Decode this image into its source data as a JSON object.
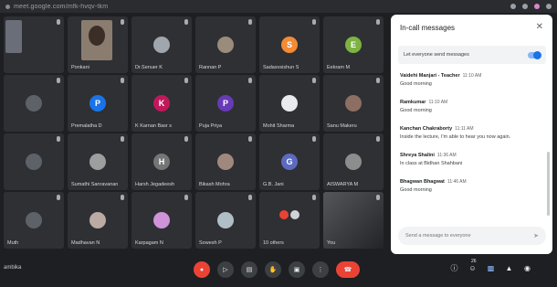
{
  "browser": {
    "url": "meet.google.com/mfk-hvqv-tkm"
  },
  "grid": {
    "tiles": [
      {
        "name": "",
        "type": "video-peer",
        "avatar_color": "#3a3b3f"
      },
      {
        "name": "Ponkani",
        "type": "video-photo",
        "avatar_color": "#8a7d70"
      },
      {
        "name": "Dr.Senuer K",
        "type": "avatar",
        "avatar_letter": "",
        "avatar_color": "#a0a6ad"
      },
      {
        "name": "Rannan P",
        "type": "avatar",
        "avatar_letter": "",
        "avatar_color": "#9a8c7c"
      },
      {
        "name": "Sadasvsishun S",
        "type": "avatar",
        "avatar_letter": "S",
        "avatar_color": "#f28b33"
      },
      {
        "name": "Eekram M",
        "type": "avatar",
        "avatar_letter": "E",
        "avatar_color": "#7cb342"
      },
      {
        "name": "",
        "type": "avatar",
        "avatar_letter": "",
        "avatar_color": "#5d6268"
      },
      {
        "name": "Premalatha D",
        "type": "avatar",
        "avatar_letter": "P",
        "avatar_color": "#1a73e8"
      },
      {
        "name": "K Karnan Basr s",
        "type": "avatar",
        "avatar_letter": "K",
        "avatar_color": "#c2185b"
      },
      {
        "name": "Puja Priya",
        "type": "avatar",
        "avatar_letter": "P",
        "avatar_color": "#673ab7"
      },
      {
        "name": "Mohit Sharma",
        "type": "avatar",
        "avatar_letter": "",
        "avatar_color": "#e8eaed"
      },
      {
        "name": "Sanu Makeru",
        "type": "avatar",
        "avatar_letter": "",
        "avatar_color": "#8d6e63"
      },
      {
        "name": "",
        "type": "avatar",
        "avatar_letter": "",
        "avatar_color": "#5d6268"
      },
      {
        "name": "Sumathi Sanravanan",
        "type": "avatar",
        "avatar_letter": "",
        "avatar_color": "#9e9e9e"
      },
      {
        "name": "Harsh Jegadeesh",
        "type": "avatar",
        "avatar_letter": "H",
        "avatar_color": "#757575"
      },
      {
        "name": "Bikash Mohra",
        "type": "avatar",
        "avatar_letter": "",
        "avatar_color": "#a1887f"
      },
      {
        "name": "G.B. Jani",
        "type": "avatar",
        "avatar_letter": "G",
        "avatar_color": "#5c6bc0"
      },
      {
        "name": "AISWARYA M",
        "type": "avatar",
        "avatar_letter": "",
        "avatar_color": "#8d8d8d"
      },
      {
        "name": "Muth",
        "type": "avatar",
        "avatar_letter": "",
        "avatar_color": "#5d6268"
      },
      {
        "name": "Madhavan N",
        "type": "avatar",
        "avatar_letter": "",
        "avatar_color": "#bcaaa4"
      },
      {
        "name": "Karpagam N",
        "type": "avatar",
        "avatar_letter": "",
        "avatar_color": "#ce93d8"
      },
      {
        "name": "Sowesh P",
        "type": "avatar",
        "avatar_letter": "",
        "avatar_color": "#b0bec5"
      },
      {
        "name": "10 others",
        "type": "others",
        "avatar_letter": "",
        "avatar_color": "#cfd2d6"
      },
      {
        "name": "You",
        "type": "self-video",
        "avatar_letter": "",
        "avatar_color": "#4a4b4f"
      }
    ]
  },
  "meeting": {
    "name": "ambika"
  },
  "controls": {
    "mic_label": "mic",
    "camera_label": "cam",
    "captions_label": "cc",
    "hand_label": "hand",
    "present_label": "present",
    "more_label": "more",
    "end_label": "end"
  },
  "right_controls": {
    "participants_count": "26"
  },
  "chat": {
    "title": "In-call messages",
    "toggle_label": "Let everyone send messages",
    "messages": [
      {
        "sender": "Vaidehi Manjari - Teacher",
        "time": "11:10 AM",
        "text": "Good morning"
      },
      {
        "sender": "Ramkumar",
        "time": "11:10 AM",
        "text": "Good morning"
      },
      {
        "sender": "Kanchan Chakraborty",
        "time": "11:11 AM",
        "text": "Inside the lecture, I'm able to hear you now again."
      },
      {
        "sender": "Shreya Shalini",
        "time": "11:36 AM",
        "text": "In class at Bidhan Shahbani"
      },
      {
        "sender": "Bhagwan Bhagwat",
        "time": "11:46 AM",
        "text": "Good morning"
      }
    ],
    "compose_placeholder": "Send a message to everyone"
  }
}
